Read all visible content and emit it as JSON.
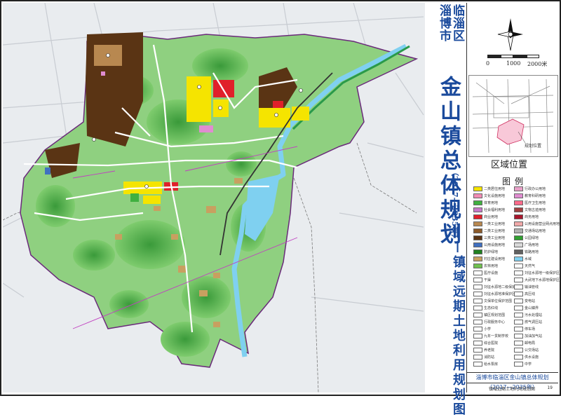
{
  "title": {
    "region_line1": "临淄区",
    "region_line2": "淄博市",
    "main": "金山镇总体规划",
    "period": "（2017—2035年）",
    "subtitle": "——镇域远期土地利用规划图"
  },
  "scale": {
    "labels": [
      "0",
      "1000",
      "2000米"
    ]
  },
  "location_map": {
    "title": "区域位置",
    "marker_label": "规划位置"
  },
  "legend": {
    "title": "图例",
    "items": [
      {
        "label": "二类居住用地",
        "color": "#f5e400"
      },
      {
        "label": "行政办公用地",
        "color": "#e8a0c8"
      },
      {
        "label": "文化设施用地",
        "color": "#f08cb4"
      },
      {
        "label": "教育科研用地",
        "color": "#e08cd0"
      },
      {
        "label": "体育用地",
        "color": "#40b040"
      },
      {
        "label": "医疗卫生用地",
        "color": "#ff6a8a"
      },
      {
        "label": "社会福利用地",
        "color": "#c878c8"
      },
      {
        "label": "文物古迹用地",
        "color": "#a04040"
      },
      {
        "label": "商业用地",
        "color": "#e0202a"
      },
      {
        "label": "商务用地",
        "color": "#a8162c"
      },
      {
        "label": "一类工业用地",
        "color": "#b88850"
      },
      {
        "label": "公用设施营业网点用地",
        "color": "#f0a8a8"
      },
      {
        "label": "二类工业用地",
        "color": "#8c5a2a"
      },
      {
        "label": "交通场站用地",
        "color": "#b0b0b0"
      },
      {
        "label": "三类工业用地",
        "color": "#5a3414"
      },
      {
        "label": "公园绿地",
        "color": "#30a030"
      },
      {
        "label": "公用设施用地",
        "color": "#4070c0"
      },
      {
        "label": "广场用地",
        "color": "#d8d8d8"
      },
      {
        "label": "防护绿地",
        "color": "#208020"
      },
      {
        "label": "铁路用地",
        "color": "#606060"
      },
      {
        "label": "村庄建设用地",
        "color": "#c8a060"
      },
      {
        "label": "水域",
        "color": "#7fd0f0"
      },
      {
        "label": "农林用地",
        "color": "#70c050"
      },
      {
        "label": "天然气",
        "color": "#ffffff"
      },
      {
        "label": "医疗设施",
        "color": "#ffffff"
      },
      {
        "label": "刘征水源地一级保护区",
        "color": "#ffffff"
      },
      {
        "label": "干渠",
        "color": "#ffffff"
      },
      {
        "label": "大武地下水源地保护区",
        "color": "#ffffff"
      },
      {
        "label": "刘征水源地二级保护区",
        "color": "#ffffff"
      },
      {
        "label": "输油管线",
        "color": "#ffffff"
      },
      {
        "label": "刘征水源地准保护区",
        "color": "#ffffff"
      },
      {
        "label": "高压线",
        "color": "#ffffff"
      },
      {
        "label": "文保单位保护范围",
        "color": "#ffffff"
      },
      {
        "label": "变电站",
        "color": "#ffffff"
      },
      {
        "label": "生态红线",
        "color": "#ffffff"
      },
      {
        "label": "金山镇界",
        "color": "#ffffff"
      },
      {
        "label": "镇区规划范围",
        "color": "#ffffff"
      },
      {
        "label": "污水处理站",
        "color": "#ffffff"
      },
      {
        "label": "行政服务中心",
        "color": "#ffffff"
      },
      {
        "label": "燃气调压站",
        "color": "#ffffff"
      },
      {
        "label": "小学",
        "color": "#ffffff"
      },
      {
        "label": "停车场",
        "color": "#ffffff"
      },
      {
        "label": "九年一贯制学校",
        "color": "#ffffff"
      },
      {
        "label": "加油加气站",
        "color": "#ffffff"
      },
      {
        "label": "综合医院",
        "color": "#ffffff"
      },
      {
        "label": "邮电局",
        "color": "#ffffff"
      },
      {
        "label": "养老院",
        "color": "#ffffff"
      },
      {
        "label": "公交场站",
        "color": "#ffffff"
      },
      {
        "label": "消防站",
        "color": "#ffffff"
      },
      {
        "label": "供水设施",
        "color": "#ffffff"
      },
      {
        "label": "给水泵房",
        "color": "#ffffff"
      },
      {
        "label": "中学",
        "color": "#ffffff"
      }
    ]
  },
  "footer": {
    "title": "淄博市临淄区金山镇总体规划（2017—2035年）",
    "drawing_name": "镇域远期土地利用规划图",
    "page": "19"
  },
  "colors": {
    "title_blue": "#1a4a9c",
    "forest_light": "#8fd080",
    "forest_dark": "#3a9a3a",
    "water": "#7fd0f0",
    "residential": "#f5e400",
    "industrial": "#5a3414"
  }
}
